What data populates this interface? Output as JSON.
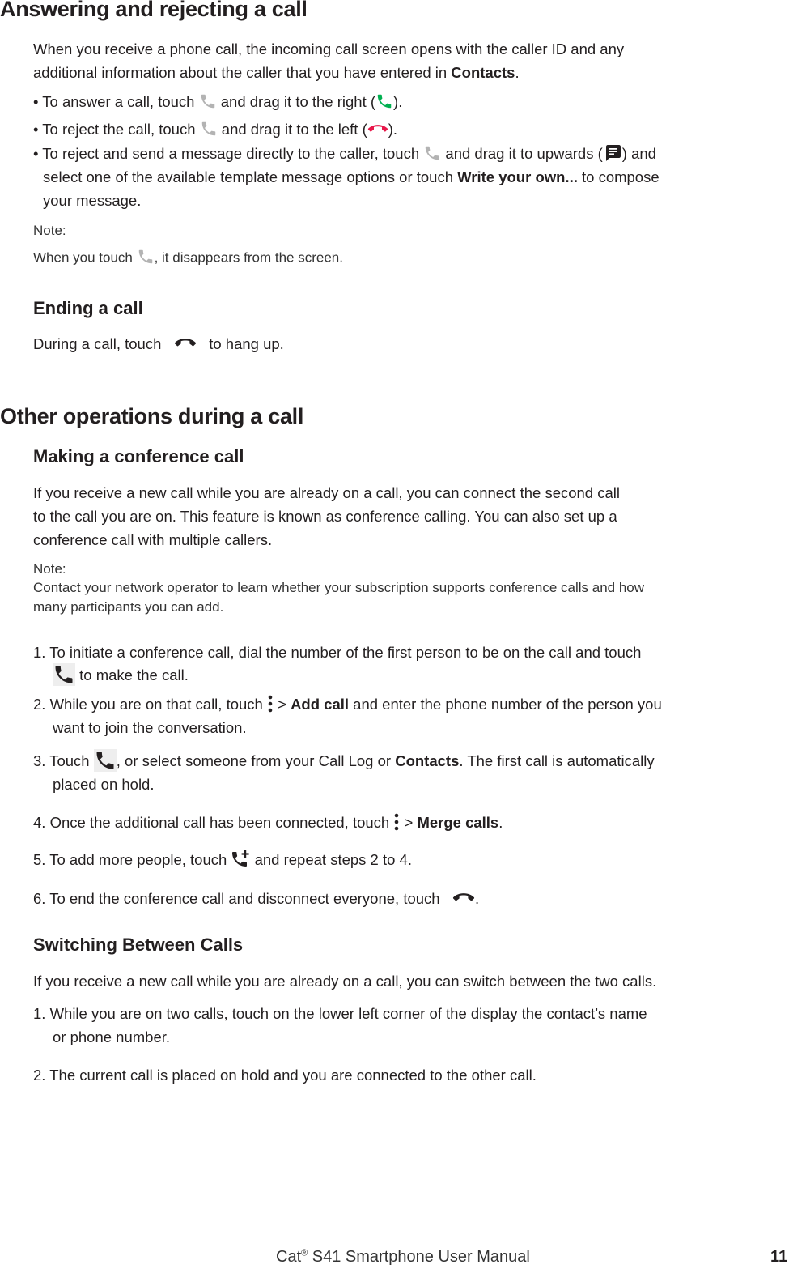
{
  "section1": {
    "title": "Answering and rejecting a call",
    "intro_line1": "When you receive a phone call, the incoming call screen opens with the caller ID and any",
    "intro_line2_a": "additional information about the caller that you have entered in ",
    "intro_line2_bold": "Contacts",
    "intro_line2_b": ".",
    "bullets": [
      {
        "a": "• To answer a call, touch ",
        "b": " and drag it to the right (",
        "c": ")."
      },
      {
        "a": "• To reject the call, touch ",
        "b": " and drag it to the left (",
        "c": ")."
      },
      {
        "a": "• To reject and send a message directly to the caller, touch ",
        "b": " and drag it to upwards (",
        "c": ") and"
      }
    ],
    "bullet3_line2_a": "select one of the available template message options or touch ",
    "bullet3_line2_bold": "Write your own...",
    "bullet3_line2_b": " to compose",
    "bullet3_line3": "your message.",
    "note_label": "Note:",
    "note_a": "When you touch ",
    "note_b": ", it disappears from the screen."
  },
  "section_ending": {
    "title": "Ending a call",
    "text_a": "During a call, touch ",
    "text_b": " to hang up."
  },
  "section2": {
    "title": "Other operations during a call",
    "conference": {
      "title": "Making a conference call",
      "lines": [
        "If you receive a new call while you are already on a call, you can connect the second call",
        "to the call you are on. This feature is known as conference calling. You can also set up a",
        "conference call with multiple callers."
      ],
      "note_label": "Note:",
      "note_lines": [
        "Contact your network operator to learn whether your subscription supports conference calls and how",
        "many participants you can add."
      ],
      "steps": {
        "s1_line1": "1. To initiate a conference call, dial the number of the first person to be on the call and touch",
        "s1_line2": " to make the call.",
        "s2_a": "2. While you are on that call, touch ",
        "s2_b": " > ",
        "s2_bold": "Add call",
        "s2_c": " and enter the phone number of the person you",
        "s2_line2": "want to join the conversation.",
        "s3_a": "3. Touch ",
        "s3_b": ", or select someone from your Call Log or ",
        "s3_bold": "Contacts",
        "s3_c": ". The first call is automatically",
        "s3_line2": "placed on hold.",
        "s4_a": "4. Once the additional call has been connected, touch ",
        "s4_b": " > ",
        "s4_bold": "Merge calls",
        "s4_c": ".",
        "s5_a": "5. To add more people, touch ",
        "s5_b": " and repeat steps 2 to 4.",
        "s6_a": "6. To end the conference call and disconnect everyone, touch ",
        "s6_b": "."
      }
    },
    "switching": {
      "title": "Switching Between Calls",
      "intro": "If you receive a new call while you are already on a call, you can switch between the two calls.",
      "s1_line1": "1. While you are on two calls, touch on the lower left corner of the display the contact’s name",
      "s1_line2": "or phone number.",
      "s2": "2. The current call is placed on hold and you are connected to the other call."
    }
  },
  "footer": {
    "brand": "Cat",
    "reg": "®",
    "title": " S41 Smartphone User Manual",
    "page_number": "11"
  },
  "icons": {
    "phone_gray": "phone-icon",
    "phone_green": "answer-call-icon",
    "hangup_red": "reject-call-icon",
    "message": "message-icon",
    "hangup_black": "end-call-icon",
    "more": "more-options-icon",
    "add_call": "add-call-icon"
  },
  "colors": {
    "text": "#231f20",
    "icon_gray": "#b3b3b3",
    "answer_green": "#00b050",
    "reject_red": "#e8174a"
  }
}
